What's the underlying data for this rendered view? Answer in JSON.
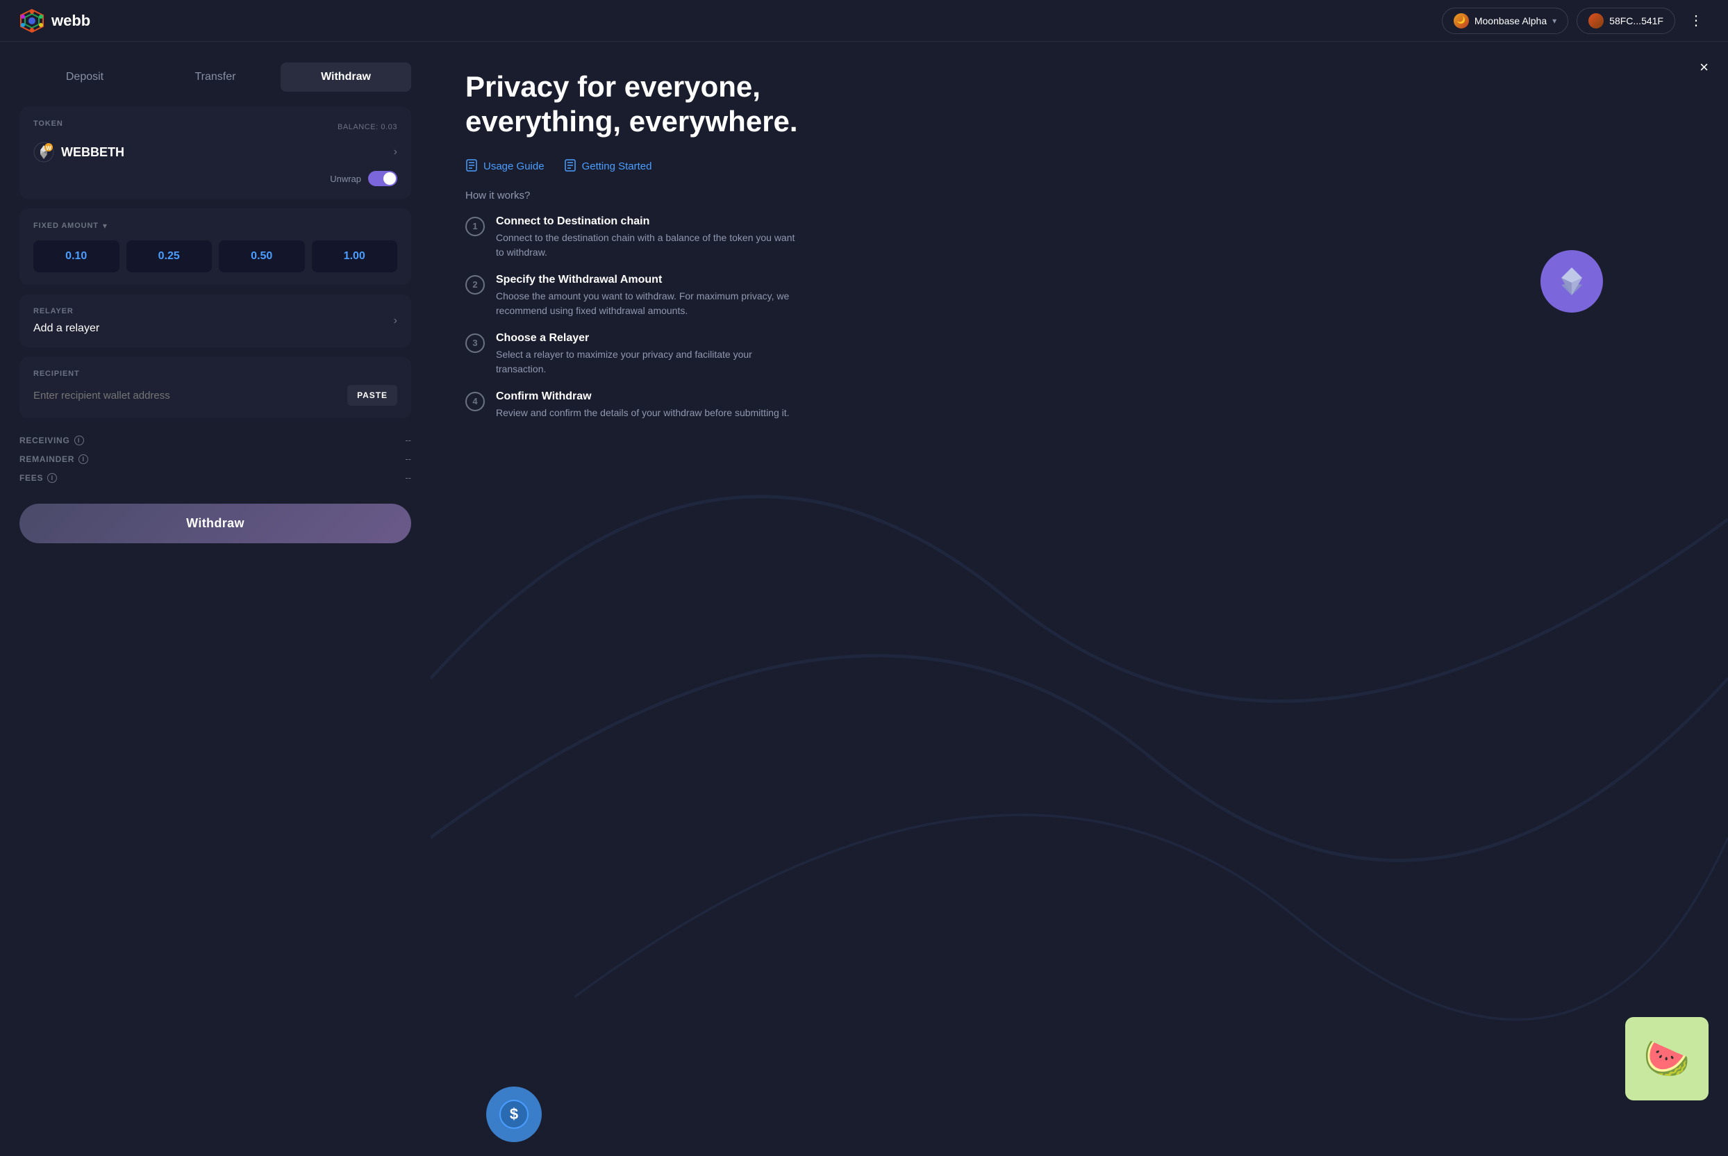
{
  "header": {
    "logo_text": "webb",
    "network_label": "Moonbase Alpha",
    "wallet_label": "58FC...541F",
    "more_label": "⋮"
  },
  "tabs": [
    {
      "id": "deposit",
      "label": "Deposit"
    },
    {
      "id": "transfer",
      "label": "Transfer"
    },
    {
      "id": "withdraw",
      "label": "Withdraw",
      "active": true
    }
  ],
  "token_section": {
    "label": "TOKEN",
    "balance_label": "BALANCE: 0.03",
    "token_name": "WEBBETH"
  },
  "unwrap": {
    "label": "Unwrap",
    "enabled": true
  },
  "fixed_amount": {
    "label": "FIXED AMOUNT",
    "options": [
      "0.10",
      "0.25",
      "0.50",
      "1.00"
    ]
  },
  "relayer": {
    "label": "RELAYER",
    "placeholder": "Add a relayer"
  },
  "recipient": {
    "label": "RECIPIENT",
    "placeholder": "Enter recipient wallet address",
    "paste_btn": "PASTE"
  },
  "info_rows": [
    {
      "label": "RECEIVING",
      "value": "--"
    },
    {
      "label": "REMAINDER",
      "value": "--"
    },
    {
      "label": "FEES",
      "value": "--"
    }
  ],
  "withdraw_btn": "Withdraw",
  "right_panel": {
    "hero_title": "Privacy for everyone, everything, everywhere.",
    "close_btn": "×",
    "guide_links": [
      {
        "label": "Usage Guide",
        "icon": "📖"
      },
      {
        "label": "Getting Started",
        "icon": "📋"
      }
    ],
    "how_it_works": "How it works?",
    "steps": [
      {
        "number": "1",
        "title": "Connect to Destination chain",
        "desc": "Connect to the destination chain with a balance of the token you want to withdraw."
      },
      {
        "number": "2",
        "title": "Specify the Withdrawal Amount",
        "desc": "Choose the amount you want to withdraw. For maximum privacy, we recommend using fixed withdrawal amounts."
      },
      {
        "number": "3",
        "title": "Choose a Relayer",
        "desc": "Select a relayer to maximize your privacy and facilitate your transaction."
      },
      {
        "number": "4",
        "title": "Confirm Withdraw",
        "desc": "Review and confirm the details of your withdraw before submitting it."
      }
    ]
  }
}
